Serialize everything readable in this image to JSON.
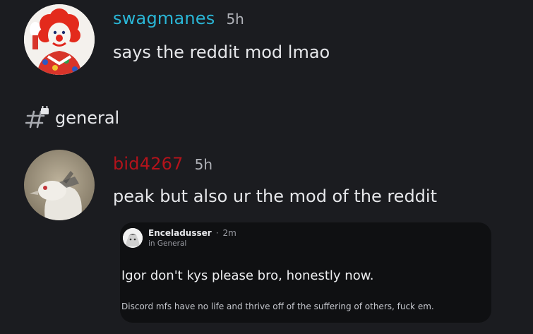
{
  "messages": [
    {
      "username": "swagmanes",
      "username_color": "#2ab6d6",
      "timestamp": "5h",
      "text": "says the reddit mod lmao",
      "avatar_icon": "clown-avatar"
    },
    {
      "username": "bid4267",
      "username_color": "#b3131b",
      "timestamp": "5h",
      "text": "peak but also ur the mod of the reddit",
      "avatar_icon": "bird-avatar"
    }
  ],
  "channel": {
    "name": "general",
    "icon": "locked-hash-icon"
  },
  "embed": {
    "username": "Enceladusser",
    "separator": "·",
    "timestamp": "2m",
    "channel": "in General",
    "title": "Igor don't kys please bro, honestly now.",
    "body": "Discord mfs have no life and thrive off of the suffering of others, fuck em.",
    "avatar_icon": "anime-avatar"
  }
}
